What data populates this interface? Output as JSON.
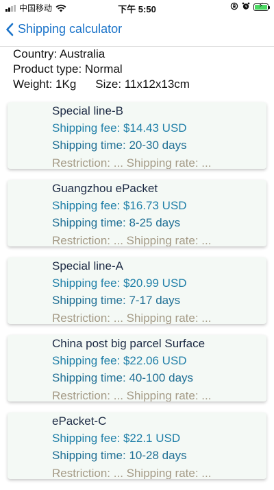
{
  "status_bar": {
    "carrier": "中国移动",
    "time": "下午 5:50"
  },
  "nav": {
    "title": "Shipping calculator"
  },
  "summary": {
    "country": "Country: Australia",
    "product_type": "Product type: Normal",
    "weight": "Weight: 1Kg",
    "size": "Size: 11x12x13cm"
  },
  "options": [
    {
      "name": "Special line-B",
      "fee": "Shipping fee: $14.43 USD",
      "time": "Shipping time: 20-30 days",
      "restriction": "Restriction: ... Shipping rate: ..."
    },
    {
      "name": "Guangzhou ePacket",
      "fee": "Shipping fee: $16.73 USD",
      "time": "Shipping time: 8-25 days",
      "restriction": "Restriction: ... Shipping rate: ..."
    },
    {
      "name": "Special line-A",
      "fee": "Shipping fee: $20.99 USD",
      "time": "Shipping time: 7-17 days",
      "restriction": "Restriction: ... Shipping rate: ..."
    },
    {
      "name": "China post big parcel Surface",
      "fee": "Shipping fee: $22.06 USD",
      "time": "Shipping time: 40-100 days",
      "restriction": "Restriction: ... Shipping rate: ..."
    },
    {
      "name": "ePacket-C",
      "fee": "Shipping fee: $22.1 USD",
      "time": "Shipping time: 10-28 days",
      "restriction": "Restriction: ... Shipping rate: ..."
    }
  ],
  "colors": {
    "accent": "#1a73c9",
    "card_bg": "#f4f9f5",
    "fee_text": "#1f7fa8",
    "muted_text": "#a49a86"
  },
  "icons": {
    "back": "chevron-left-icon",
    "wifi": "wifi-icon",
    "battery": "battery-charging-icon",
    "lock": "orientation-lock-icon",
    "alarm": "alarm-icon"
  }
}
